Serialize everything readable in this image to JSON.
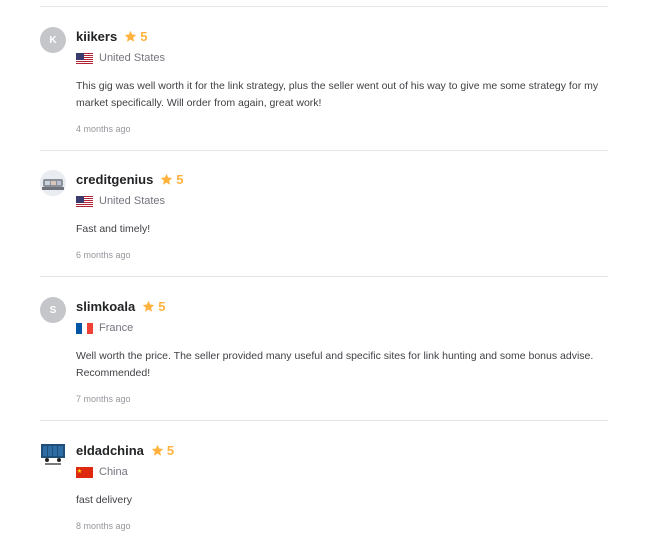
{
  "reviews": [
    {
      "avatar_letter": "K",
      "username": "kiikers",
      "rating": "5",
      "country": "United States",
      "flag": "us-flag",
      "text": "This gig was well worth it for the link strategy, plus the seller went out of his way to give me some strategy for my market specifically. Will order from again, great work!",
      "time": "4 months ago"
    },
    {
      "avatar_letter": "",
      "username": "creditgenius",
      "rating": "5",
      "country": "United States",
      "flag": "us-flag",
      "text": "Fast and timely!",
      "time": "6 months ago"
    },
    {
      "avatar_letter": "S",
      "username": "slimkoala",
      "rating": "5",
      "country": "France",
      "flag": "fr-flag",
      "text": "Well worth the price. The seller provided many useful and specific sites for link hunting and some bonus advise. Recommended!",
      "time": "7 months ago"
    },
    {
      "avatar_letter": "",
      "username": "eldadchina",
      "rating": "5",
      "country": "China",
      "flag": "cn-flag",
      "text": "fast delivery",
      "time": "8 months ago"
    }
  ],
  "colors": {
    "star": "#ffb33e",
    "divider": "#e4e5e7",
    "muted": "#74767e"
  }
}
